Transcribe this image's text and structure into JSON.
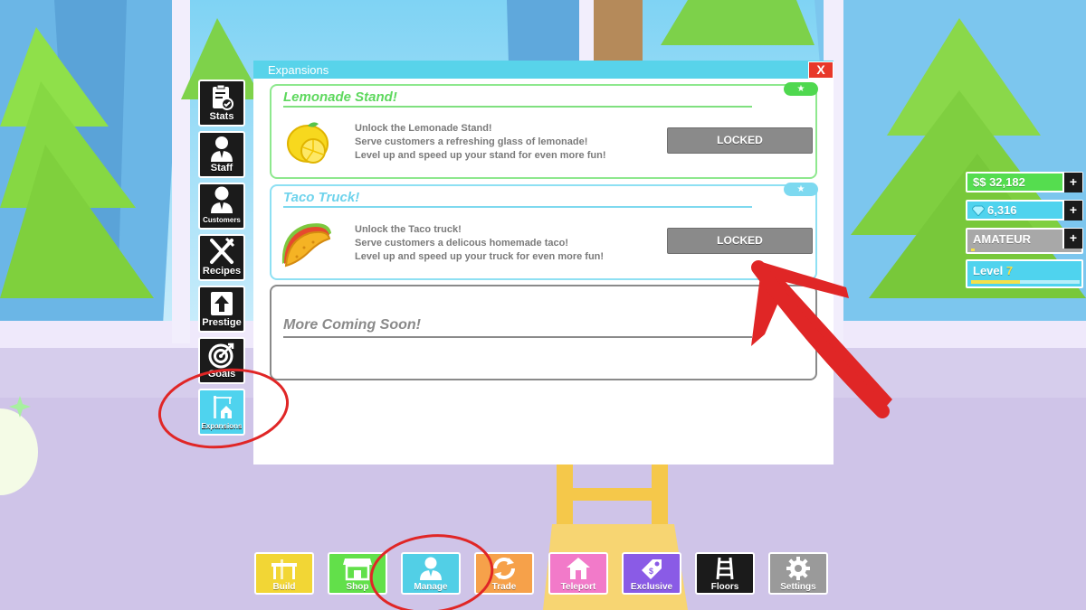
{
  "sidebar": {
    "items": [
      {
        "label": "Stats",
        "icon": "stats-clipboard-icon"
      },
      {
        "label": "Staff",
        "icon": "staff-person-icon"
      },
      {
        "label": "Customers",
        "icon": "customer-person-icon"
      },
      {
        "label": "Recipes",
        "icon": "fork-knife-icon"
      },
      {
        "label": "Prestige",
        "icon": "up-arrow-icon"
      },
      {
        "label": "Goals",
        "icon": "target-icon"
      },
      {
        "label": "Expansions",
        "icon": "expansion-building-icon",
        "active": true
      }
    ]
  },
  "window": {
    "title": "Expansions",
    "close_label": "X",
    "cards": [
      {
        "name": "Lemonade Stand!",
        "icon": "lemon-icon",
        "lines": [
          "Unlock the Lemonade Stand!",
          "Serve customers a refreshing glass of lemonade!",
          "Level up and speed up your stand for even more fun!"
        ],
        "button": "LOCKED",
        "badge": "★",
        "color": "#5ee062"
      },
      {
        "name": "Taco Truck!",
        "icon": "taco-icon",
        "lines": [
          "Unlock the Taco truck!",
          "Serve customers a delicous homemade taco!",
          "Level up and speed up your truck for even more fun!"
        ],
        "button": "LOCKED",
        "badge": "★",
        "color": "#6fd8ee"
      }
    ],
    "coming_soon": "More Coming Soon!"
  },
  "stats": {
    "cash": "$$ 32,182",
    "gems": "6,316",
    "rank": "AMATEUR",
    "level_label": "Level",
    "level_value": "7",
    "level_progress": 0.45,
    "plus": "+"
  },
  "toolbar": [
    {
      "label": "Build",
      "icon": "build-table-icon",
      "color": "#f2d635"
    },
    {
      "label": "Shop",
      "icon": "shop-store-icon",
      "color": "#62e04a"
    },
    {
      "label": "Manage",
      "icon": "manage-person-icon",
      "color": "#52cfe6"
    },
    {
      "label": "Trade",
      "icon": "trade-arrows-icon",
      "color": "#f6a14a"
    },
    {
      "label": "Teleport",
      "icon": "teleport-house-icon",
      "color": "#f27ac9"
    },
    {
      "label": "Exclusive",
      "icon": "exclusive-tag-icon",
      "color": "#8a5be6"
    },
    {
      "label": "Floors",
      "icon": "floors-ladder-icon",
      "color": "#1b1b1b"
    },
    {
      "label": "Settings",
      "icon": "settings-gear-icon",
      "color": "#9a9a9a"
    }
  ],
  "colors": {
    "accent": "#58d3ea",
    "close": "#e8382a",
    "annotation": "#e02626"
  }
}
